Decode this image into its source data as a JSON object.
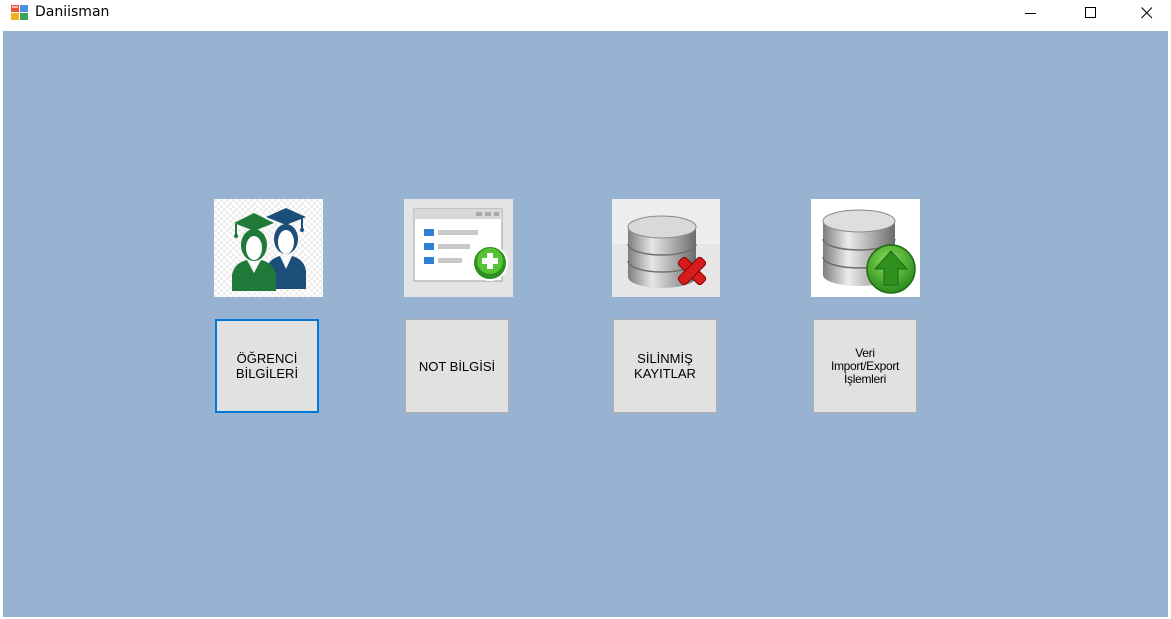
{
  "window": {
    "title": "Daniisman",
    "icons": {
      "app": "app-form-icon",
      "minimize": "minimize-icon",
      "maximize": "maximize-icon",
      "close": "close-icon"
    }
  },
  "colors": {
    "client_background": "#98b3d1",
    "button_face": "#e1e1e1",
    "focus_border": "#0078d7"
  },
  "menu": {
    "items": [
      {
        "label": "ÖĞRENCİ\nBİLGİLERİ",
        "icon": "students-graduation-icon"
      },
      {
        "label": "NOT BİLGİSİ",
        "icon": "add-record-list-icon"
      },
      {
        "label": "SİLİNMİŞ\nKAYITLAR",
        "icon": "database-delete-icon"
      },
      {
        "label": "Veri\nImport/Export\nİşlemleri",
        "icon": "database-upload-icon"
      }
    ]
  }
}
